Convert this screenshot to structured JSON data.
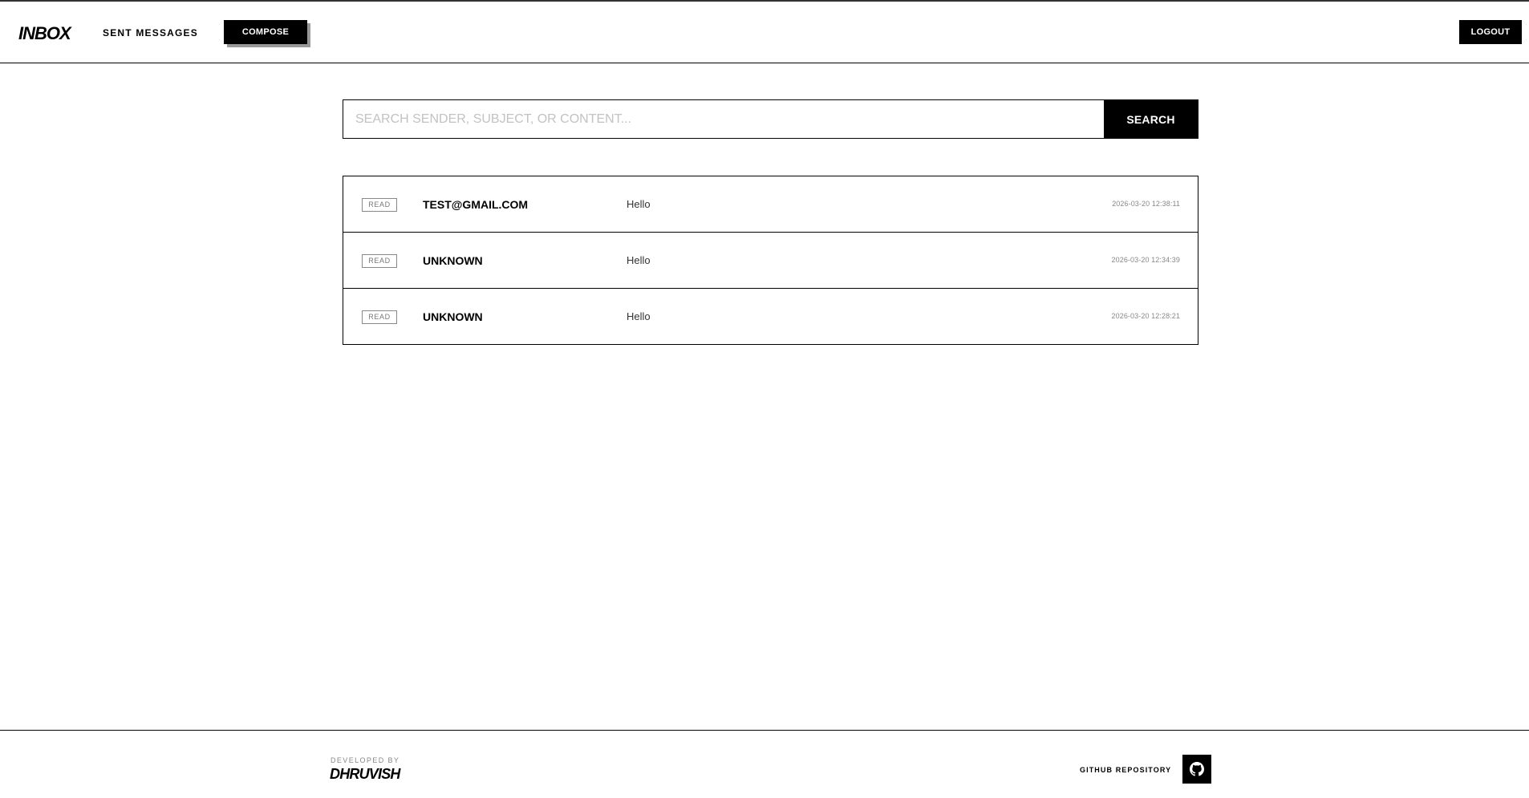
{
  "header": {
    "logo": "INBOX",
    "nav_sent": "SENT MESSAGES",
    "compose_label": "COMPOSE",
    "logout_label": "LOGOUT"
  },
  "search": {
    "placeholder": "SEARCH SENDER, SUBJECT, OR CONTENT...",
    "value": "",
    "button_label": "SEARCH"
  },
  "messages": [
    {
      "status": "READ",
      "sender": "TEST@GMAIL.COM",
      "subject": "Hello",
      "date": "2026-03-20 12:38:11"
    },
    {
      "status": "READ",
      "sender": "UNKNOWN",
      "subject": "Hello",
      "date": "2026-03-20 12:34:39"
    },
    {
      "status": "READ",
      "sender": "UNKNOWN",
      "subject": "Hello",
      "date": "2026-03-20 12:28:21"
    }
  ],
  "footer": {
    "developed_by_label": "DEVELOPED BY",
    "developer_name": "DHRUVISH",
    "github_label": "GITHUB REPOSITORY",
    "github_icon": "github-icon"
  }
}
